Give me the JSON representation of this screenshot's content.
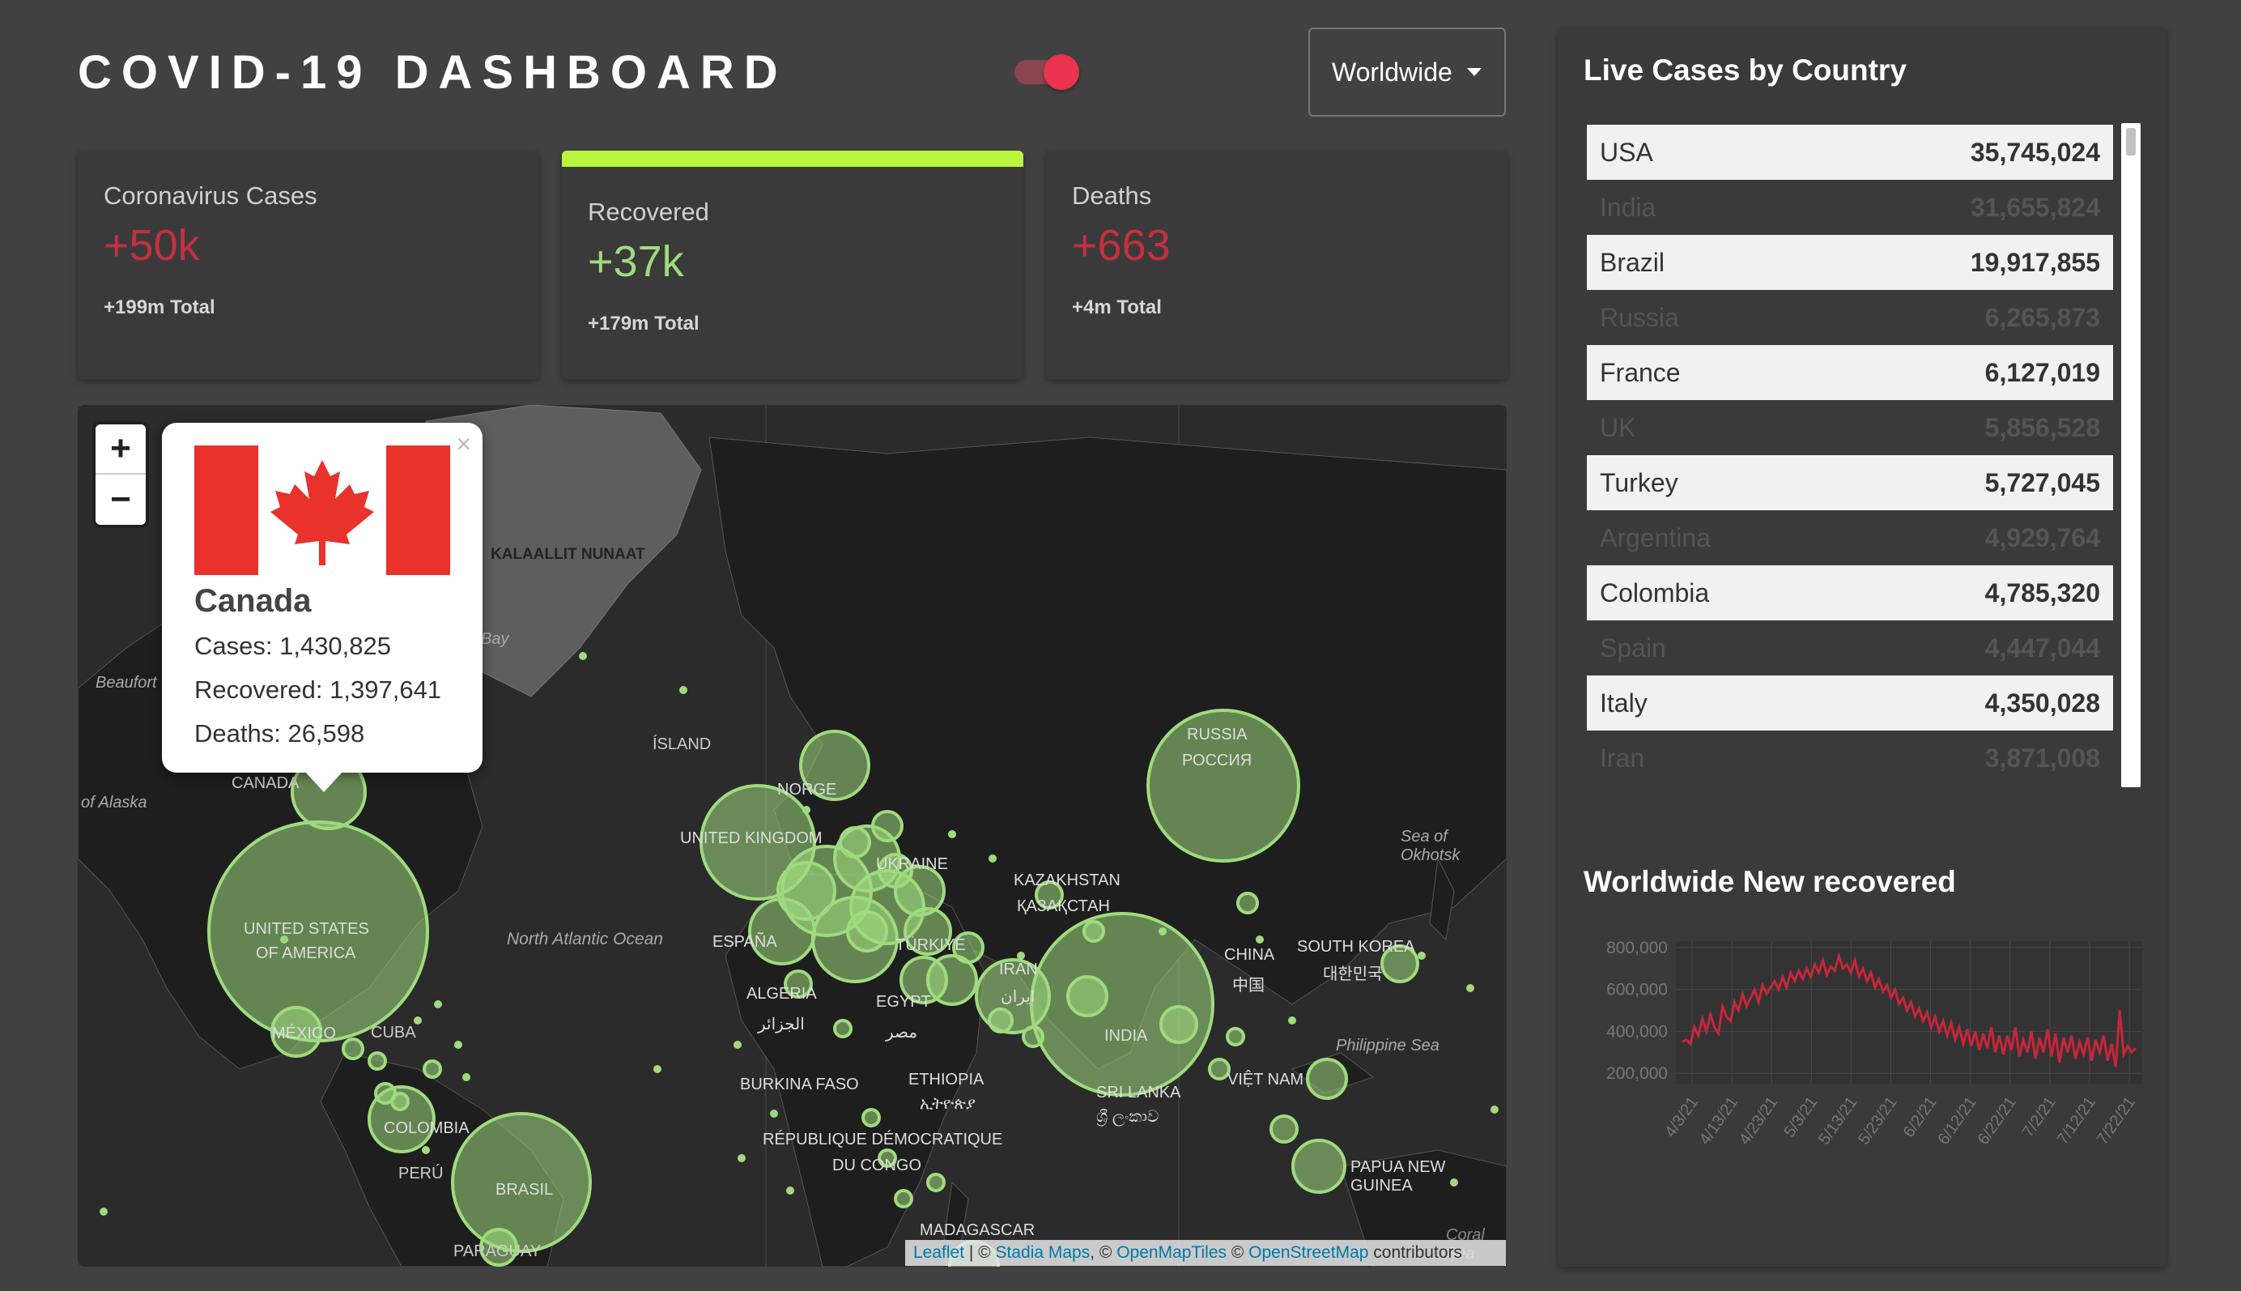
{
  "header": {
    "title": "COVID-19 DASHBOARD",
    "region_select": "Worldwide"
  },
  "stats": [
    {
      "label": "Coronavirus Cases",
      "value": "+50k",
      "total": "+199m Total",
      "color": "#c6303e"
    },
    {
      "label": "Recovered",
      "value": "+37k",
      "total": "+179m Total",
      "color": "#9fdb7e"
    },
    {
      "label": "Deaths",
      "value": "+663",
      "total": "+4m Total",
      "color": "#c6303e"
    }
  ],
  "map": {
    "zoom_in": "+",
    "zoom_out": "−",
    "popup": {
      "country": "Canada",
      "cases": "Cases: 1,430,825",
      "recovered": "Recovered: 1,397,641",
      "deaths": "Deaths: 26,598",
      "close": "×"
    },
    "labels": {
      "greenland": "KALAALLIT NUNAAT",
      "iceland": "ÍSLAND",
      "canada": "CANADA",
      "usa1": "UNITED STATES",
      "usa2": "OF AMERICA",
      "mexico": "MÉXICO",
      "cuba": "CUBA",
      "colombia": "COLOMBIA",
      "peru": "PERÚ",
      "brasil": "BRASIL",
      "paraguay": "PARAGUAY",
      "atlantic": "North Atlantic Ocean",
      "beaufort": "Beaufort",
      "alaska": "of Alaska",
      "bay": "Bay",
      "norge": "NORGE",
      "uk": "UNITED KINGDOM",
      "ukraine": "UKRAINE",
      "espana": "ESPAÑA",
      "turkiye": "TÜRKIYE",
      "algeria1": "ALGERIA",
      "algeria2": "الجزائر",
      "egypt1": "EGYPT",
      "egypt2": "مصر",
      "burkina": "BURKINA FASO",
      "ethiopia1": "ETHIOPIA",
      "ethiopia2": "ኢትዮጵያ",
      "rdc1": "RÉPUBLIQUE DÉMOCRATIQUE",
      "rdc2": "DU CONGO",
      "madagascar": "MADAGASCAR",
      "kazakhstan1": "KAZAKHSTAN",
      "kazakhstan2": "ҚАЗАҚСТАН",
      "iran1": "IRAN",
      "iran2": "ایران",
      "india": "INDIA",
      "srilanka1": "SRI LANKA",
      "srilanka2": "ශ්‍රී ලංකාව",
      "russia1": "RUSSIA",
      "russia2": "РОССИЯ",
      "china1": "CHINA",
      "china2": "中国",
      "korea1": "SOUTH KOREA",
      "korea2": "대한민국",
      "vietnam": "VIỆT NAM",
      "okhotsk": "Sea of Okhotsk",
      "philippine": "Philippine Sea",
      "papua": "PAPUA NEW GUINEA",
      "coral": "Coral Sea"
    },
    "attribution": {
      "leaflet": "Leaflet",
      "sep1": " | © ",
      "stadia": "Stadia Maps",
      "sep2": ", © ",
      "omt": "OpenMapTiles",
      "sep3": " © ",
      "osm": "OpenStreetMap",
      "tail": " contributors"
    }
  },
  "live_cases": {
    "title": "Live Cases by Country",
    "rows": [
      {
        "country": "USA",
        "cases": "35,745,024"
      },
      {
        "country": "India",
        "cases": "31,655,824"
      },
      {
        "country": "Brazil",
        "cases": "19,917,855"
      },
      {
        "country": "Russia",
        "cases": "6,265,873"
      },
      {
        "country": "France",
        "cases": "6,127,019"
      },
      {
        "country": "UK",
        "cases": "5,856,528"
      },
      {
        "country": "Turkey",
        "cases": "5,727,045"
      },
      {
        "country": "Argentina",
        "cases": "4,929,764"
      },
      {
        "country": "Colombia",
        "cases": "4,785,320"
      },
      {
        "country": "Spain",
        "cases": "4,447,044"
      },
      {
        "country": "Italy",
        "cases": "4,350,028"
      },
      {
        "country": "Iran",
        "cases": "3,871,008"
      }
    ]
  },
  "chart_data": {
    "type": "line",
    "title": "Worldwide New recovered",
    "color": "#c8263a",
    "ylim": [
      150000,
      800000
    ],
    "y_ticks": [
      "800,000",
      "600,000",
      "400,000",
      "200,000"
    ],
    "x_ticks": [
      "4/3/21",
      "4/13/21",
      "4/23/21",
      "5/3/21",
      "5/13/21",
      "5/23/21",
      "6/2/21",
      "6/12/21",
      "6/22/21",
      "7/2/21",
      "7/12/21",
      "7/22/21"
    ],
    "series": [
      {
        "values": [
          350000,
          360000,
          340000,
          420000,
          380000,
          460000,
          400000,
          480000,
          420000,
          390000,
          520000,
          470000,
          450000,
          540000,
          500000,
          580000,
          520000,
          560000,
          600000,
          540000,
          620000,
          580000,
          610000,
          640000,
          600000,
          660000,
          610000,
          680000,
          640000,
          690000,
          650000,
          700000,
          660000,
          720000,
          680000,
          740000,
          670000,
          710000,
          690000,
          760000,
          700000,
          720000,
          680000,
          740000,
          660000,
          700000,
          640000,
          680000,
          610000,
          650000,
          590000,
          620000,
          560000,
          600000,
          530000,
          560000,
          500000,
          540000,
          470000,
          510000,
          450000,
          490000,
          420000,
          470000,
          400000,
          450000,
          380000,
          440000,
          360000,
          420000,
          340000,
          410000,
          330000,
          400000,
          310000,
          390000,
          320000,
          420000,
          300000,
          380000,
          290000,
          380000,
          310000,
          420000,
          280000,
          360000,
          300000,
          400000,
          270000,
          370000,
          300000,
          410000,
          280000,
          390000,
          250000,
          370000,
          300000,
          380000,
          270000,
          350000,
          290000,
          370000,
          260000,
          360000,
          300000,
          380000,
          260000,
          340000,
          230000,
          500000,
          290000,
          330000,
          300000,
          320000
        ]
      }
    ]
  }
}
